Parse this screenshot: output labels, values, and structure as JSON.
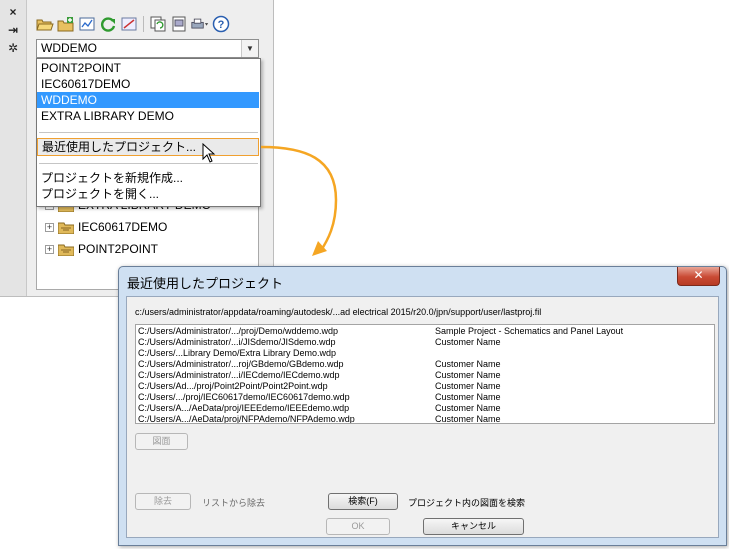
{
  "palette": {
    "strip_buttons": [
      "×",
      "⇥",
      "✲"
    ],
    "toolbar_icons": [
      "open-project-icon",
      "new-project-icon",
      "properties-icon",
      "refresh-icon",
      "update-icon",
      "copy-icon",
      "report-icon",
      "plot-icon",
      "help-icon"
    ],
    "combo_value": "WDDEMO",
    "dropdown": {
      "items": [
        "POINT2POINT",
        "IEC60617DEMO",
        "WDDEMO",
        "EXTRA LIBRARY DEMO"
      ],
      "selected": "WDDEMO",
      "recent": "最近使用したプロジェクト...",
      "new_project": "プロジェクトを新規作成...",
      "open_project": "プロジェクトを開く..."
    },
    "tree": {
      "items": [
        "EXTRA LIBRARY DEMO",
        "IEC60617DEMO",
        "POINT2POINT"
      ]
    }
  },
  "dialog": {
    "title": "最近使用したプロジェクト",
    "close_label": "✕",
    "file_path": "c:/users/administrator/appdata/roaming/autodesk/...ad electrical 2015/r20.0/jpn/support/user/lastproj.fil",
    "projects": [
      {
        "path": "C:/Users/Administrator/.../proj/Demo/wddemo.wdp",
        "desc": "Sample Project - Schematics and Panel Layout"
      },
      {
        "path": "C:/Users/Administrator/...i/JISdemo/JISdemo.wdp",
        "desc": "Customer Name"
      },
      {
        "path": "C:/Users/...Library Demo/Extra Library Demo.wdp",
        "desc": ""
      },
      {
        "path": "C:/Users/Administrator/...roj/GBdemo/GBdemo.wdp",
        "desc": "Customer Name"
      },
      {
        "path": "C:/Users/Administrator/...i/IECdemo/IECdemo.wdp",
        "desc": "Customer Name"
      },
      {
        "path": "C:/Users/Ad.../proj/Point2Point/Point2Point.wdp",
        "desc": "Customer Name"
      },
      {
        "path": "C:/Users/.../proj/IEC60617demo/IEC60617demo.wdp",
        "desc": "Customer Name"
      },
      {
        "path": "C:/Users/A.../AeData/proj/IEEEdemo/IEEEdemo.wdp",
        "desc": "Customer Name"
      },
      {
        "path": "C:/Users/A.../AeData/proj/NFPAdemo/NFPAdemo.wdp",
        "desc": "Customer Name"
      }
    ],
    "drawing_button": "図面",
    "remove_button": "除去",
    "remove_label": "リストから除去",
    "search_button": "検索(F)",
    "search_label": "プロジェクト内の図面を検索",
    "ok_button": "OK",
    "cancel_button": "キャンセル"
  },
  "colors": {
    "accent": "#f0a030",
    "selection": "#3399ff",
    "dialog_frame": "#cfe0f2",
    "close_button": "#c94a34"
  }
}
